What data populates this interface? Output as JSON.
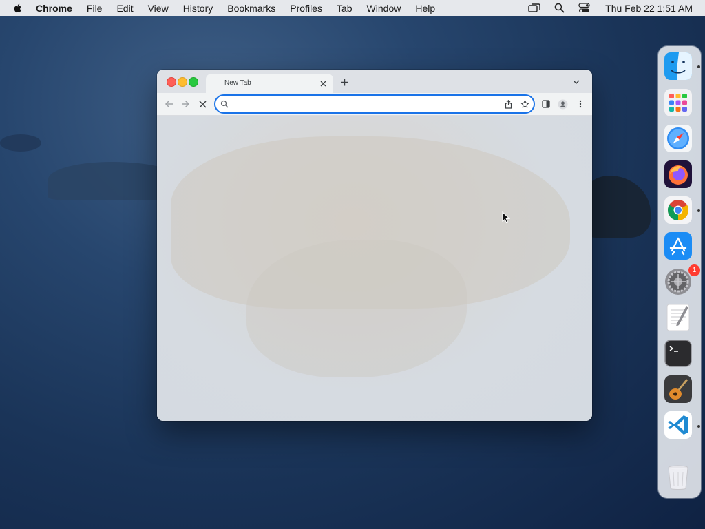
{
  "menubar": {
    "app_name": "Chrome",
    "items": [
      "File",
      "Edit",
      "View",
      "History",
      "Bookmarks",
      "Profiles",
      "Tab",
      "Window",
      "Help"
    ],
    "clock": "Thu Feb 22  1:51 AM",
    "status_icons": [
      "screen-mirroring-icon",
      "spotlight-search-icon",
      "control-center-icon"
    ]
  },
  "browser": {
    "tab": {
      "title": "New Tab"
    },
    "omnibox": {
      "value": "",
      "placeholder": ""
    },
    "accent_color": "#1a73e8"
  },
  "dock": {
    "items": [
      {
        "name": "Finder",
        "icon": "finder-icon",
        "running": true
      },
      {
        "name": "Launchpad",
        "icon": "launchpad-icon",
        "running": false
      },
      {
        "name": "Safari",
        "icon": "safari-icon",
        "running": false
      },
      {
        "name": "Firefox",
        "icon": "firefox-icon",
        "running": false
      },
      {
        "name": "Google Chrome",
        "icon": "chrome-icon",
        "running": true
      },
      {
        "name": "App Store",
        "icon": "app-store-icon",
        "running": false
      },
      {
        "name": "System Preferences",
        "icon": "system-preferences-icon",
        "running": false,
        "badge": "1"
      },
      {
        "name": "TextEdit",
        "icon": "textedit-icon",
        "running": false
      },
      {
        "name": "Terminal",
        "icon": "terminal-icon",
        "running": false
      },
      {
        "name": "GarageBand",
        "icon": "garageband-icon",
        "running": false
      },
      {
        "name": "Visual Studio Code",
        "icon": "vscode-icon",
        "running": true
      },
      {
        "name": "Trash",
        "icon": "trash-icon",
        "running": false
      }
    ]
  }
}
